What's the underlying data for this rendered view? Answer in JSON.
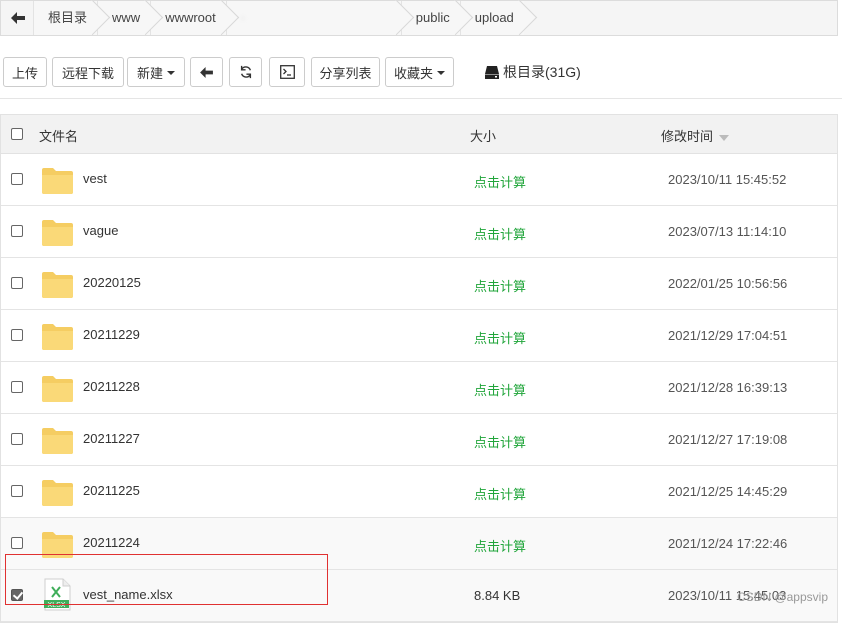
{
  "breadcrumb": {
    "items": [
      "根目录",
      "www",
      "wwwroot",
      "·",
      "public",
      "upload"
    ]
  },
  "toolbar": {
    "upload": "上传",
    "remote_download": "远程下载",
    "new": "新建",
    "share_list": "分享列表",
    "favorites": "收藏夹",
    "disk_label": "根目录(31G)"
  },
  "table": {
    "headers": {
      "name": "文件名",
      "size": "大小",
      "modified": "修改时间"
    },
    "rows": [
      {
        "name": "vest",
        "type": "folder",
        "size": "点击计算",
        "time": "2023/10/11 15:45:52",
        "checked": false
      },
      {
        "name": "vague",
        "type": "folder",
        "size": "点击计算",
        "time": "2023/07/13 11:14:10",
        "checked": false
      },
      {
        "name": "20220125",
        "type": "folder",
        "size": "点击计算",
        "time": "2022/01/25 10:56:56",
        "checked": false
      },
      {
        "name": "20211229",
        "type": "folder",
        "size": "点击计算",
        "time": "2021/12/29 17:04:51",
        "checked": false
      },
      {
        "name": "20211228",
        "type": "folder",
        "size": "点击计算",
        "time": "2021/12/28 16:39:13",
        "checked": false
      },
      {
        "name": "20211227",
        "type": "folder",
        "size": "点击计算",
        "time": "2021/12/27 17:19:08",
        "checked": false
      },
      {
        "name": "20211225",
        "type": "folder",
        "size": "点击计算",
        "time": "2021/12/25 14:45:29",
        "checked": false
      },
      {
        "name": "20211224",
        "type": "folder",
        "size": "点击计算",
        "time": "2021/12/24 17:22:46",
        "checked": false
      },
      {
        "name": "vest_name.xlsx",
        "type": "xlsx",
        "size": "8.84 KB",
        "time": "2023/10/11 15:45:03",
        "checked": true
      }
    ]
  },
  "icons": {
    "folder": "folder-icon",
    "xlsx": "excel-file-icon",
    "xlsx_label": "XLSX"
  },
  "colors": {
    "calc_link": "#20a53a",
    "folder": "#f9d46b",
    "highlight": "#e03131"
  },
  "watermark": "CSDN @appsvip"
}
